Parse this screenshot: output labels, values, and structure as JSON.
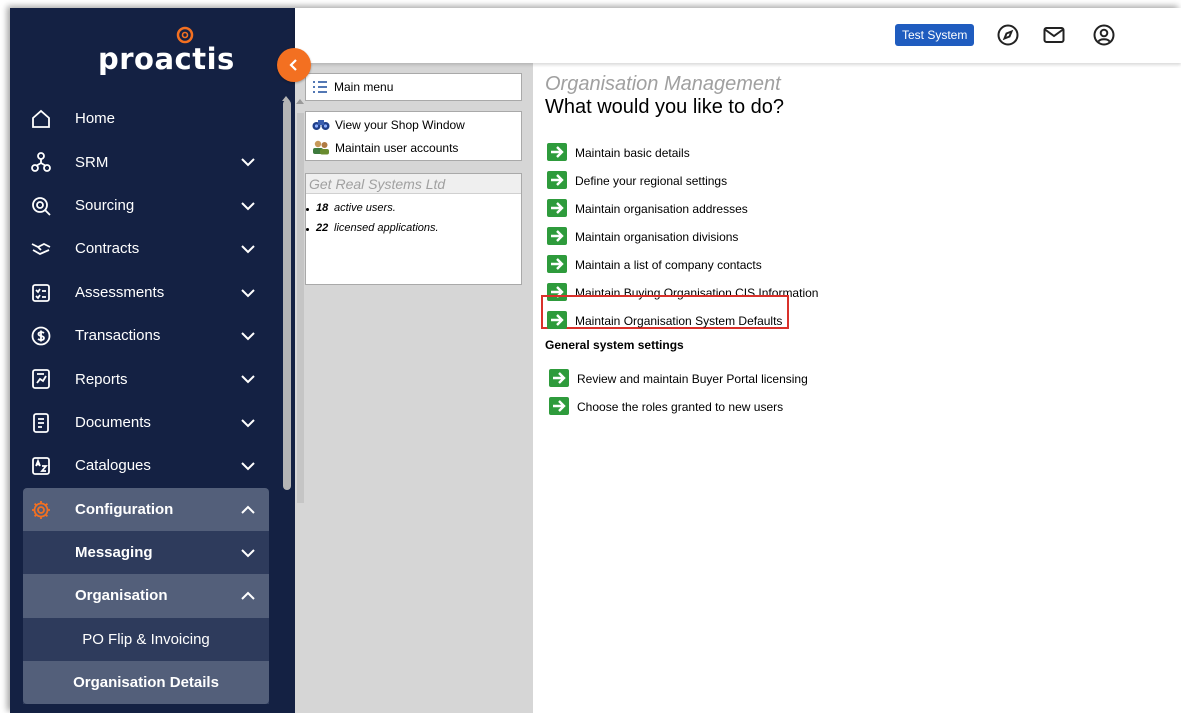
{
  "brand": {
    "name": "proactis",
    "accent": "#f37021",
    "sidebar_bg": "#142143"
  },
  "sidebar": {
    "items": [
      {
        "label": "Home",
        "icon": "home-icon"
      },
      {
        "label": "SRM",
        "icon": "network-icon"
      },
      {
        "label": "Sourcing",
        "icon": "search-icon"
      },
      {
        "label": "Contracts",
        "icon": "handshake-icon"
      },
      {
        "label": "Assessments",
        "icon": "checklist-icon"
      },
      {
        "label": "Transactions",
        "icon": "currency-icon"
      },
      {
        "label": "Reports",
        "icon": "report-icon"
      },
      {
        "label": "Documents",
        "icon": "document-icon"
      },
      {
        "label": "Catalogues",
        "icon": "catalogue-icon"
      }
    ],
    "configuration": {
      "label": "Configuration",
      "messaging": "Messaging",
      "organisation": "Organisation",
      "po_flip": "PO Flip & Invoicing",
      "org_details": "Organisation Details"
    }
  },
  "topbar": {
    "badge": "Test System"
  },
  "left_panel": {
    "main_menu": "Main menu",
    "shortcuts": [
      "View your Shop Window",
      "Maintain user accounts"
    ],
    "org_name": "Get Real Systems Ltd",
    "stats": [
      {
        "num": "18",
        "text": "active users."
      },
      {
        "num": "22",
        "text": "licensed applications."
      }
    ]
  },
  "main": {
    "section_title": "Organisation Management",
    "heading": "What would you like to do?",
    "actions": [
      "Maintain basic details",
      "Define your regional settings",
      "Maintain organisation addresses",
      "Maintain organisation divisions",
      "Maintain a list of company contacts",
      "Maintain Buying Organisation CIS Information",
      "Maintain Organisation System Defaults"
    ],
    "general_heading": "General system settings",
    "general_actions": [
      "Review and maintain Buyer Portal licensing",
      "Choose the roles granted to new users"
    ]
  }
}
